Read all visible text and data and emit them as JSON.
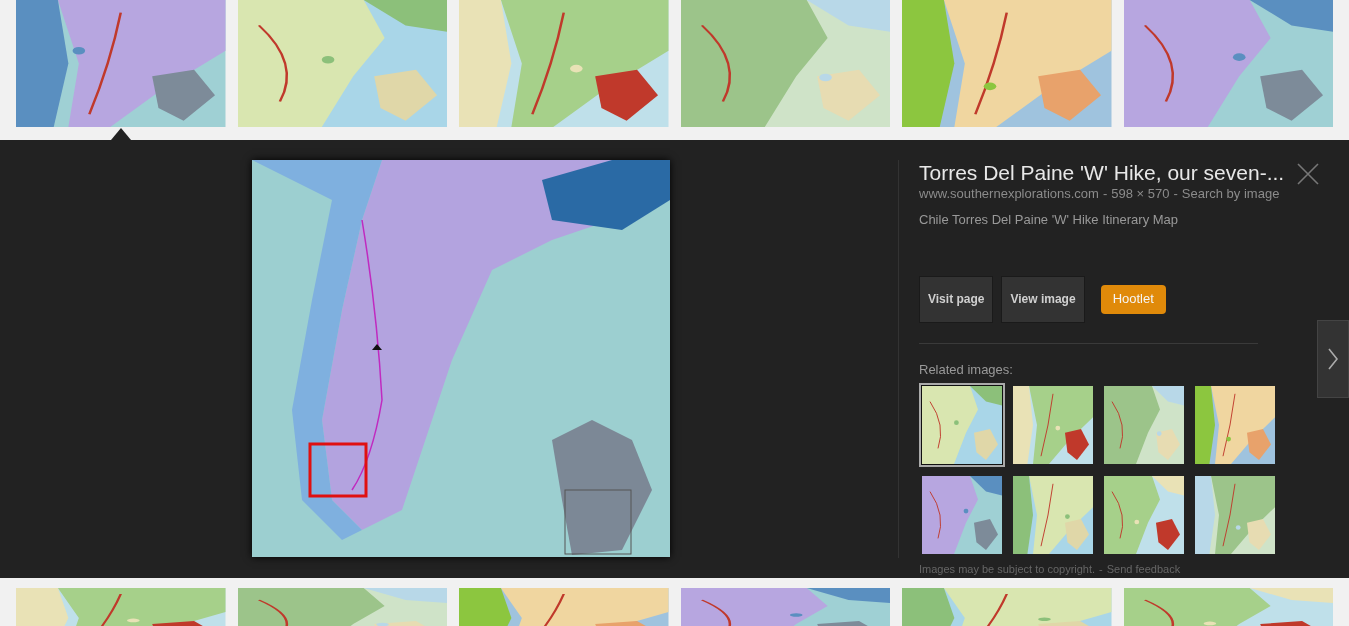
{
  "top_results": [
    {
      "kind": "picture",
      "selected": true
    },
    {
      "kind": "picture",
      "selected": false
    },
    {
      "kind": "picture",
      "selected": false
    },
    {
      "kind": "picture",
      "selected": false
    },
    {
      "kind": "picture",
      "selected": false
    },
    {
      "kind": "picture",
      "selected": false
    }
  ],
  "preview": {
    "title": "Torres Del Paine 'W' Hike, our seven-...",
    "source": "www.southernexplorations.com",
    "separator": "-",
    "size": "598 × 570",
    "search_link": "Search by image",
    "description": "Chile Torres Del Paine 'W' Hike Itinerary Map",
    "buttons": [
      {
        "label": "Visit page",
        "kind": "dark"
      },
      {
        "label": "View image",
        "kind": "dark"
      },
      {
        "label": "Hootlet",
        "kind": "orange"
      }
    ],
    "related_label": "Related images:",
    "related": [
      {
        "selected": true
      },
      {
        "selected": false
      },
      {
        "selected": false
      },
      {
        "selected": false
      },
      {
        "selected": false
      },
      {
        "selected": false
      },
      {
        "selected": false
      },
      {
        "selected": false
      }
    ],
    "copyright": "Images may be subject to copyright.",
    "feedback_link": "Send feedback"
  },
  "bottom_results": [
    {
      "kind": "picture"
    },
    {
      "kind": "picture"
    },
    {
      "kind": "picture"
    },
    {
      "kind": "picture"
    },
    {
      "kind": "picture"
    },
    {
      "kind": "picture"
    }
  ]
}
